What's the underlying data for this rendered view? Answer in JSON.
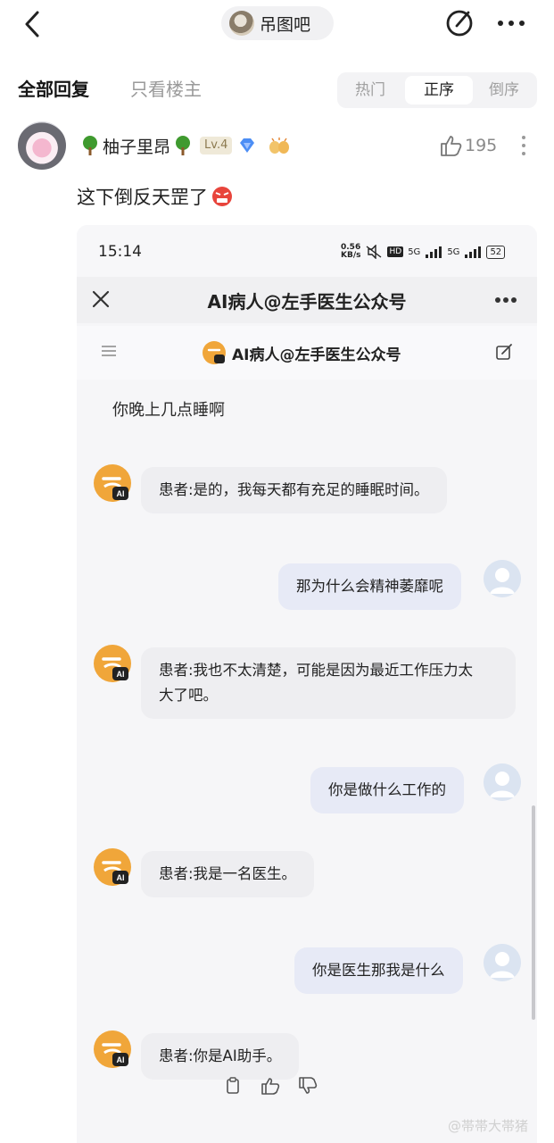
{
  "topbar": {
    "forum_name": "吊图吧",
    "back_icon": "chevron-left-icon",
    "edit_icon": "edit-icon",
    "more_icon": "more-horizontal-icon"
  },
  "filters": {
    "all_replies": "全部回复",
    "owner_only": "只看楼主",
    "sort_options": [
      "热门",
      "正序",
      "倒序"
    ],
    "sort_selected": "正序"
  },
  "reply": {
    "username": "柚子里昂",
    "level": "Lv.4",
    "likes": "195",
    "text": "这下倒反天罡了"
  },
  "embed": {
    "status_time": "15:14",
    "net_speed_top": "0.56",
    "net_speed_bottom": "KB/s",
    "hd_label": "HD",
    "signal_label_1": "5G",
    "signal_label_2": "5G",
    "battery": "52",
    "title": "AI病人@左手医生公众号",
    "chat_title": "AI病人@左手医生公众号",
    "messages": [
      {
        "side": "right-plain",
        "text": "你晚上几点睡啊"
      },
      {
        "side": "left",
        "text": "患者:是的，我每天都有充足的睡眠时间。"
      },
      {
        "side": "right",
        "text": "那为什么会精神萎靡呢"
      },
      {
        "side": "left",
        "text_line1": "患者:我也不太清楚，可能是因为最近工作压力太",
        "text_line2": "大了吧。"
      },
      {
        "side": "right",
        "text": "你是做什么工作的"
      },
      {
        "side": "left",
        "text": "患者:我是一名医生。"
      },
      {
        "side": "right",
        "text": "你是医生那我是什么"
      },
      {
        "side": "left",
        "text": "患者:你是AI助手。"
      }
    ],
    "ai_badge": "AI"
  },
  "watermark": "@帯帯大帯猪",
  "colors": {
    "accent_orange": "#f0a63a",
    "bubble_left": "#eeeef1",
    "bubble_right": "#e7eaf6"
  }
}
